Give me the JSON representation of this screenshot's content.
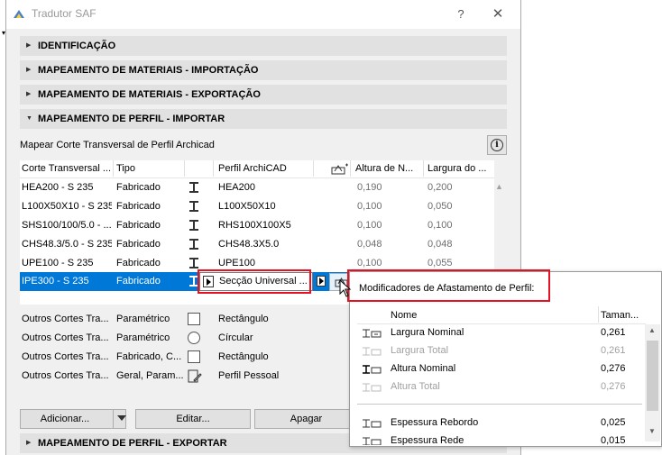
{
  "window": {
    "title": "Tradutor SAF",
    "help_label": "?",
    "close_label": "✕"
  },
  "sections": {
    "identificacao": "IDENTIFICAÇÃO",
    "mat_import": "MAPEAMENTO DE MATERIAIS - IMPORTAÇÃO",
    "mat_export": "MAPEAMENTO DE MATERIAIS - EXPORTAÇÃO",
    "perfil_import": "MAPEAMENTO DE PERFIL - IMPORTAR",
    "perfil_export": "MAPEAMENTO DE PERFIL - EXPORTAR"
  },
  "map_label": "Mapear Corte Transversal de Perfil Archicad",
  "info_glyph": "i",
  "table": {
    "headers": {
      "cross_section": "Corte Transversal ...",
      "type": "Tipo",
      "profile": "Perfil ArchiCAD",
      "height": "Altura de N...",
      "width": "Largura do ..."
    },
    "rows": [
      {
        "section": "HEA200 - S 235",
        "type": "Fabricado",
        "profile": "HEA200",
        "height": "0,190",
        "width": "0,200"
      },
      {
        "section": "L100X50X10 - S 235",
        "type": "Fabricado",
        "profile": "L100X50X10",
        "height": "0,100",
        "width": "0,050"
      },
      {
        "section": "SHS100/100/5.0 - ...",
        "type": "Fabricado",
        "profile": "RHS100X100X5",
        "height": "0,100",
        "width": "0,100"
      },
      {
        "section": "CHS48.3/5.0 - S 235",
        "type": "Fabricado",
        "profile": "CHS48.3X5.0",
        "height": "0,048",
        "width": "0,048"
      },
      {
        "section": "UPE100 - S 235",
        "type": "Fabricado",
        "profile": "UPE100",
        "height": "0,100",
        "width": "0,055"
      },
      {
        "section": "IPE300 - S 235",
        "type": "Fabricado",
        "profile": "Secção Universal ...",
        "height": "",
        "width": ""
      }
    ]
  },
  "others": [
    {
      "section": "Outros Cortes Tra...",
      "type": "Paramétrico",
      "profile": "Rectângulo"
    },
    {
      "section": "Outros Cortes Tra...",
      "type": "Paramétrico",
      "profile": "Círcular"
    },
    {
      "section": "Outros Cortes Tra...",
      "type": "Fabricado, C...",
      "profile": "Rectângulo"
    },
    {
      "section": "Outros Cortes Tra...",
      "type": "Geral, Param...",
      "profile": "Perfil Pessoal"
    }
  ],
  "buttons": {
    "add": "Adicionar...",
    "edit": "Editar...",
    "delete": "Apagar"
  },
  "popup": {
    "title": "Modificadores de Afastamento de Perfil:",
    "headers": {
      "name": "Nome",
      "size": "Taman..."
    },
    "rows": [
      {
        "name": "Largura Nominal",
        "size": "0,261",
        "dim": false
      },
      {
        "name": "Largura Total",
        "size": "0,261",
        "dim": true
      },
      {
        "name": "Altura Nominal",
        "size": "0,276",
        "dim": false
      },
      {
        "name": "Altura Total",
        "size": "0,276",
        "dim": true
      },
      {
        "name": "Espessura Rebordo",
        "size": "0,025",
        "dim": false
      },
      {
        "name": "Espessura Rede",
        "size": "0,015",
        "dim": false
      }
    ]
  },
  "colors": {
    "selection": "#0078d7",
    "highlight": "#e81123",
    "header_bg": "#e1e1e1"
  }
}
